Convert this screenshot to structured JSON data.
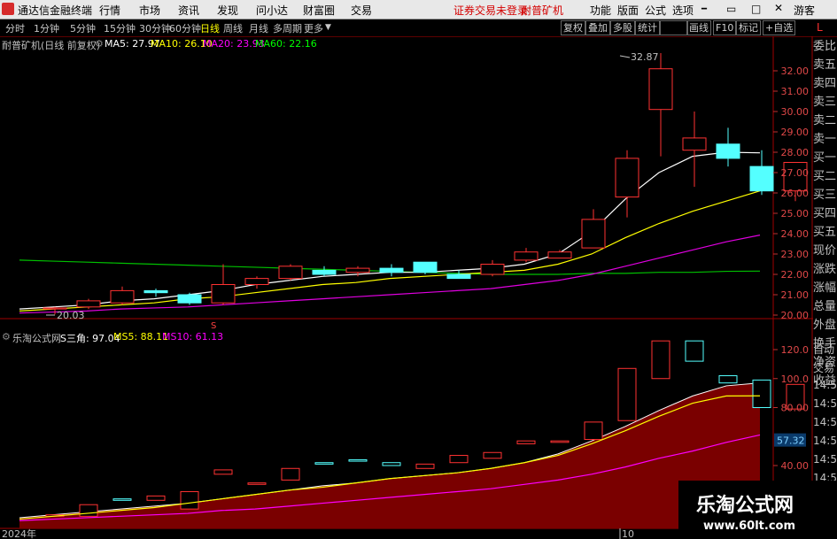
{
  "app": {
    "title": "通达信金融终端",
    "menu": [
      "行情",
      "市场",
      "资讯",
      "发现",
      "问小达",
      "财富圈",
      "交易"
    ],
    "promo_trade": "证券交易未登录",
    "promo_stock": "耐普矿机",
    "sys_menu": [
      "功能",
      "版面",
      "公式",
      "选项"
    ],
    "guest": "游客"
  },
  "periods": [
    "分时",
    "1分钟",
    "5分钟",
    "15分钟",
    "30分钟",
    "60分钟",
    "日线",
    "周线",
    "月线",
    "多周期",
    "更多"
  ],
  "active_period": "日线",
  "tools": [
    "复权",
    "叠加",
    "多股",
    "统计",
    "画线",
    "F10",
    "标记",
    "+自选"
  ],
  "mark_letter": "L",
  "main_chart": {
    "stock_title": "耐普矿机(日线 前复权)",
    "ma_labels": [
      {
        "text": "MA5: 27.97",
        "color": "#ffffff"
      },
      {
        "text": "MA10: 26.10",
        "color": "#ffff00"
      },
      {
        "text": "MA20: 23.93",
        "color": "#ff00ff"
      },
      {
        "text": "MA60: 22.16",
        "color": "#00ff00"
      }
    ],
    "y_ticks": [
      "32.00",
      "31.00",
      "30.00",
      "29.00",
      "28.00",
      "27.00",
      "26.00",
      "25.00",
      "24.00",
      "23.00",
      "22.00",
      "21.00",
      "20.00"
    ],
    "high_marker": "32.87",
    "low_marker": "20.03"
  },
  "sub_chart": {
    "title": "乐淘公式网",
    "labels": [
      {
        "text": "S三角: 97.04",
        "color": "#ffffff"
      },
      {
        "text": "MS5: 88.11",
        "color": "#ffff00"
      },
      {
        "text": "MS10: 61.13",
        "color": "#ff00ff"
      }
    ],
    "y_ticks": [
      "120.0",
      "100.0",
      "80.00",
      "40.00"
    ],
    "current_value": "57.32"
  },
  "right_panel": [
    "委比",
    "卖五",
    "卖四",
    "卖三",
    "卖二",
    "卖一",
    "买一",
    "买二",
    "买三",
    "买四",
    "买五",
    "现价",
    "涨跌",
    "涨幅",
    "总量",
    "外盘",
    "换手",
    "净资",
    "收益"
  ],
  "right_panel_sub": [
    "自动",
    "交易",
    "14:56",
    "14:56",
    "14:56",
    "14:56",
    "14:56",
    "14:56",
    "14:56",
    "14:56"
  ],
  "x_labels": {
    "year": "2024年",
    "month": "10"
  },
  "watermark": {
    "title": "乐淘公式网",
    "url": "www.60lt.com"
  },
  "chart_data": {
    "type": "candlestick",
    "candles": [
      {
        "o": 20.3,
        "h": 20.4,
        "l": 20.03,
        "c": 20.35
      },
      {
        "o": 20.4,
        "h": 20.8,
        "l": 20.3,
        "c": 20.7
      },
      {
        "o": 20.6,
        "h": 21.4,
        "l": 20.5,
        "c": 21.2
      },
      {
        "o": 21.2,
        "h": 21.3,
        "l": 20.9,
        "c": 21.1
      },
      {
        "o": 21.0,
        "h": 21.1,
        "l": 20.5,
        "c": 20.6
      },
      {
        "o": 20.6,
        "h": 22.5,
        "l": 20.5,
        "c": 21.5
      },
      {
        "o": 21.5,
        "h": 21.9,
        "l": 21.3,
        "c": 21.8
      },
      {
        "o": 21.8,
        "h": 22.5,
        "l": 21.7,
        "c": 22.4
      },
      {
        "o": 22.2,
        "h": 22.4,
        "l": 21.9,
        "c": 22.0
      },
      {
        "o": 22.1,
        "h": 22.4,
        "l": 21.9,
        "c": 22.3
      },
      {
        "o": 22.3,
        "h": 22.5,
        "l": 21.9,
        "c": 22.1
      },
      {
        "o": 22.6,
        "h": 22.6,
        "l": 22.0,
        "c": 22.1
      },
      {
        "o": 22.0,
        "h": 22.2,
        "l": 21.8,
        "c": 21.8
      },
      {
        "o": 22.0,
        "h": 22.7,
        "l": 21.9,
        "c": 22.5
      },
      {
        "o": 22.7,
        "h": 23.3,
        "l": 22.6,
        "c": 23.1
      },
      {
        "o": 22.8,
        "h": 23.2,
        "l": 22.8,
        "c": 23.1
      },
      {
        "o": 23.3,
        "h": 25.2,
        "l": 23.3,
        "c": 24.7
      },
      {
        "o": 25.8,
        "h": 28.1,
        "l": 24.8,
        "c": 27.7
      },
      {
        "o": 30.1,
        "h": 32.87,
        "l": 27.8,
        "c": 32.1
      },
      {
        "o": 28.1,
        "h": 30.0,
        "l": 26.3,
        "c": 28.7
      },
      {
        "o": 28.4,
        "h": 29.2,
        "l": 27.3,
        "c": 27.7
      },
      {
        "o": 27.3,
        "h": 28.1,
        "l": 25.9,
        "c": 26.1
      },
      {
        "o": 26.1,
        "h": 27.5,
        "l": 25.6,
        "c": 27.5
      }
    ],
    "ma5": [
      20.3,
      20.4,
      20.5,
      20.7,
      20.8,
      21.0,
      21.2,
      21.5,
      21.7,
      21.9,
      22.0,
      22.1,
      22.1,
      22.2,
      22.3,
      22.5,
      23.0,
      24.1,
      25.7,
      27.0,
      27.8,
      28.0,
      27.97
    ],
    "ma10": [
      20.2,
      20.3,
      20.4,
      20.5,
      20.6,
      20.8,
      20.9,
      21.1,
      21.3,
      21.5,
      21.6,
      21.8,
      21.9,
      22.0,
      22.1,
      22.2,
      22.5,
      23.0,
      23.8,
      24.5,
      25.1,
      25.6,
      26.1
    ],
    "ma20": [
      20.1,
      20.15,
      20.2,
      20.3,
      20.35,
      20.4,
      20.5,
      20.6,
      20.7,
      20.8,
      20.9,
      21.0,
      21.1,
      21.2,
      21.3,
      21.5,
      21.7,
      22.0,
      22.4,
      22.8,
      23.2,
      23.6,
      23.93
    ],
    "ma60": [
      22.7,
      22.65,
      22.6,
      22.55,
      22.5,
      22.45,
      22.4,
      22.35,
      22.3,
      22.25,
      22.2,
      22.15,
      22.1,
      22.05,
      22.0,
      22.0,
      22.0,
      22.05,
      22.05,
      22.1,
      22.1,
      22.15,
      22.16
    ],
    "sub_boxes": [
      {
        "o": 5,
        "c": 6
      },
      {
        "o": 5,
        "c": 13
      },
      {
        "o": 17,
        "c": 16
      },
      {
        "o": 16,
        "c": 19
      },
      {
        "o": 10,
        "c": 22
      },
      {
        "o": 34,
        "c": 37
      },
      {
        "o": 27,
        "c": 28
      },
      {
        "o": 30,
        "c": 38
      },
      {
        "o": 42,
        "c": 41
      },
      {
        "o": 44,
        "c": 43
      },
      {
        "o": 42,
        "c": 40
      },
      {
        "o": 38,
        "c": 41
      },
      {
        "o": 42,
        "c": 47
      },
      {
        "o": 45,
        "c": 49
      },
      {
        "o": 55,
        "c": 57
      },
      {
        "o": 56,
        "c": 57
      },
      {
        "o": 58,
        "c": 70
      },
      {
        "o": 71,
        "c": 107
      },
      {
        "o": 100,
        "c": 126
      },
      {
        "o": 126,
        "c": 112
      },
      {
        "o": 102,
        "c": 97
      },
      {
        "o": 99,
        "c": 80
      },
      {
        "o": 79,
        "c": 96
      }
    ],
    "sub_area": [
      4,
      6,
      8,
      10,
      12,
      14,
      17,
      20,
      23,
      26,
      28,
      31,
      33,
      35,
      38,
      42,
      48,
      57,
      67,
      78,
      88,
      95,
      97
    ],
    "ms5": [
      3,
      5,
      7,
      9,
      11,
      14,
      17,
      20,
      23,
      25,
      28,
      31,
      33,
      35,
      38,
      42,
      47,
      55,
      64,
      74,
      83,
      88,
      88.11
    ],
    "ms10": [
      2,
      3,
      4,
      5,
      6,
      7,
      9,
      10,
      12,
      14,
      16,
      18,
      20,
      22,
      24,
      27,
      30,
      34,
      39,
      45,
      50,
      56,
      61.13
    ]
  }
}
